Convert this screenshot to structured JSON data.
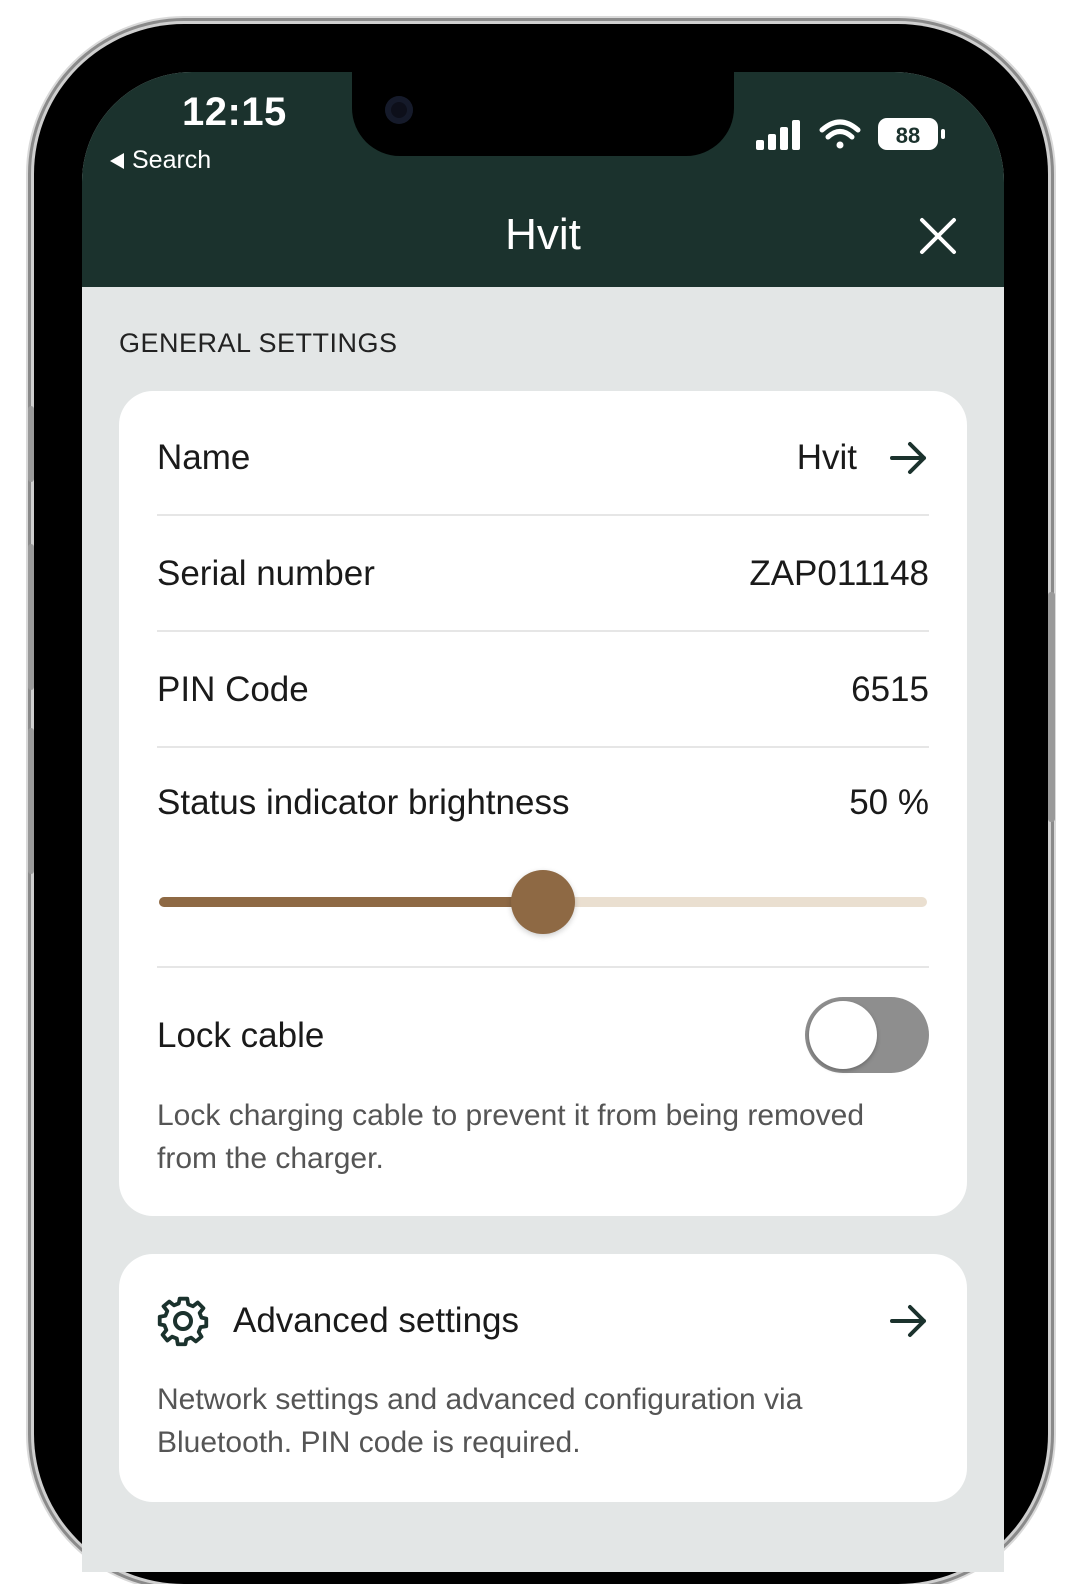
{
  "status_bar": {
    "time": "12:15",
    "back_label": "Search",
    "battery": "88"
  },
  "header": {
    "title": "Hvit"
  },
  "general_settings": {
    "section_label": "GENERAL SETTINGS",
    "name": {
      "label": "Name",
      "value": "Hvit"
    },
    "serial": {
      "label": "Serial number",
      "value": "ZAP011148"
    },
    "pin": {
      "label": "PIN Code",
      "value": "6515"
    },
    "brightness": {
      "label": "Status indicator brightness",
      "value": "50 %",
      "level": 0.5
    },
    "lock_cable": {
      "label": "Lock cable",
      "enabled": false,
      "description": "Lock charging cable to prevent it from being removed from the charger."
    }
  },
  "advanced": {
    "label": "Advanced settings",
    "description": "Network settings and advanced configuration via Bluetooth. PIN code is required."
  },
  "colors": {
    "header_bg": "#1b322d",
    "screen_bg": "#e3e6e6",
    "slider_accent": "#8e6944",
    "slider_track": "#eadfd0",
    "toggle_off": "#8e8e8e"
  },
  "icons": [
    "back-triangle-icon",
    "signal-icon",
    "wifi-icon",
    "battery-icon",
    "close-icon",
    "arrow-right-icon",
    "gear-icon"
  ]
}
